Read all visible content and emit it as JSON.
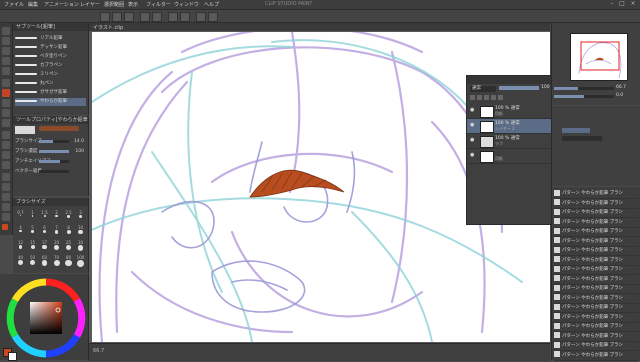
{
  "menubar": {
    "items": [
      "ファイル",
      "編集",
      "アニメーション",
      "レイヤー",
      "選択範囲",
      "表示",
      "フィルター",
      "ウィンドウ",
      "ヘルプ"
    ],
    "window_title": "CLIP STUDIO PAINT"
  },
  "subtool": {
    "title": "サブツール[鉛筆]",
    "brushes": [
      "リアル鉛筆",
      "デッサン鉛筆",
      "ベタ塗りペン",
      "カブラペン",
      "ミリペン",
      "丸ペン",
      "ガサガサ鉛筆",
      "やわらか鉛筆"
    ],
    "selected_index": 7
  },
  "toolprop": {
    "title": "ツールプロパティ[やわらか鉛筆]",
    "brush_name": "やわらか鉛筆",
    "rows": [
      {
        "label": "ブラシサイズ",
        "value": "14.0",
        "fill": 0.45
      },
      {
        "label": "ブラシ濃度",
        "value": "100",
        "fill": 1.0
      },
      {
        "label": "アンチエイリアス",
        "value": "",
        "fill": 0.7
      },
      {
        "label": "ベクター吸着",
        "value": "",
        "fill": 0.0
      }
    ]
  },
  "brushsize": {
    "title": "ブラシサイズ",
    "sizes": [
      "0.7",
      "1",
      "1.5",
      "2",
      "2.5",
      "3",
      "4",
      "5",
      "6",
      "7",
      "8",
      "10",
      "12",
      "15",
      "17",
      "20",
      "25",
      "30",
      "40",
      "50",
      "60",
      "70",
      "80",
      "100"
    ]
  },
  "color": {
    "main": "#c84a1c",
    "sub": "#ffffff"
  },
  "canvas": {
    "tab_label": "イラスト.clip",
    "zoom": "66.7"
  },
  "layers": {
    "blend_mode": "通常",
    "opacity": "100",
    "rows": [
      {
        "name": "100 % 通常",
        "sub": "用紙",
        "selected": false
      },
      {
        "name": "100 % 通常",
        "sub": "レイヤー 2",
        "selected": true
      },
      {
        "name": "100 % 通常",
        "sub": "ラフ",
        "selected": false
      },
      {
        "name": "",
        "sub": "用紙",
        "selected": false
      }
    ]
  },
  "navigator": {
    "zoom": "66.7",
    "angle": "0.0"
  },
  "material": {
    "rows": [
      "パターン やわらか鉛筆 ブラシ",
      "パターン やわらか鉛筆 ブラシ",
      "パターン やわらか鉛筆 ブラシ",
      "パターン やわらか鉛筆 ブラシ",
      "パターン やわらか鉛筆 ブラシ",
      "パターン やわらか鉛筆 ブラシ",
      "パターン やわらか鉛筆 ブラシ",
      "パターン やわらか鉛筆 ブラシ",
      "パターン やわらか鉛筆 ブラシ",
      "パターン やわらか鉛筆 ブラシ",
      "パターン やわらか鉛筆 ブラシ",
      "パターン やわらか鉛筆 ブラシ",
      "パターン やわらか鉛筆 ブラシ",
      "パターン やわらか鉛筆 ブラシ",
      "パターン やわらか鉛筆 ブラシ",
      "パターン やわらか鉛筆 ブラシ",
      "パターン やわらか鉛筆 ブラシ",
      "パターン やわらか鉛筆 ブラシ"
    ]
  }
}
